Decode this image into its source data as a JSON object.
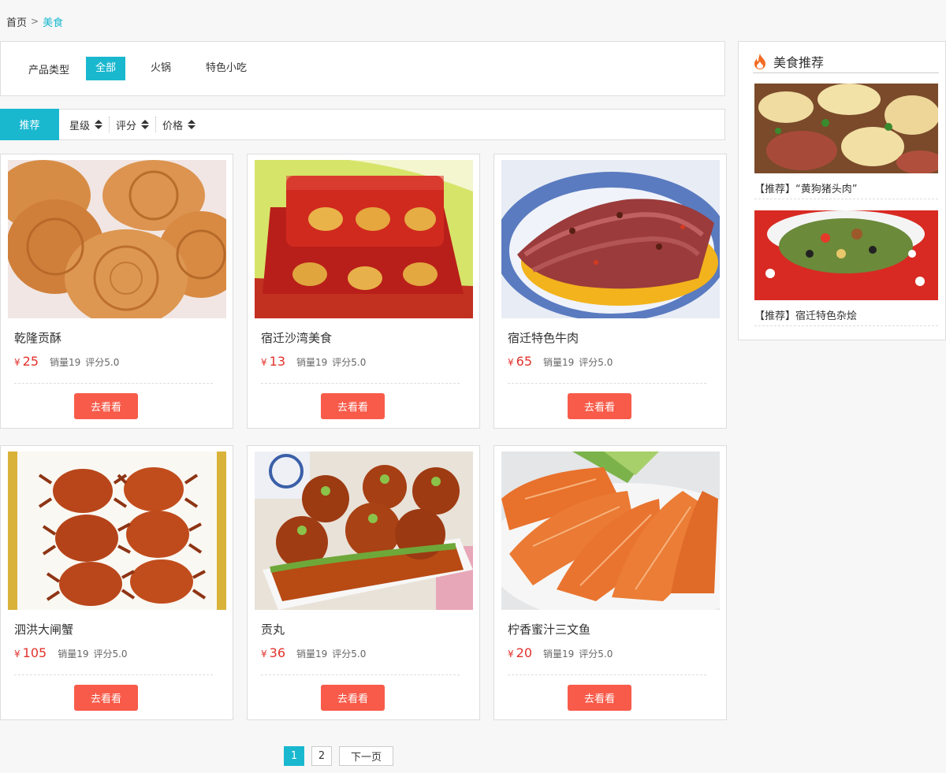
{
  "breadcrumb": {
    "home": "首页",
    "current": "美食"
  },
  "filter": {
    "title": "产品类型",
    "options": [
      {
        "label": "全部",
        "active": true
      },
      {
        "label": "火锅",
        "active": false
      },
      {
        "label": "特色小吃",
        "active": false
      }
    ]
  },
  "sort": {
    "active": "推荐",
    "items": [
      "星级",
      "评分",
      "价格"
    ]
  },
  "products": [
    {
      "name": "乾隆贡酥",
      "currency": "¥",
      "price": "25",
      "sales": "销量19",
      "rating": "评分5.0",
      "button": "去看看",
      "image": "pastry"
    },
    {
      "name": "宿迁沙湾美食",
      "currency": "¥",
      "price": "13",
      "sales": "销量19",
      "rating": "评分5.0",
      "button": "去看看",
      "image": "jelly"
    },
    {
      "name": "宿迁特色牛肉",
      "currency": "¥",
      "price": "65",
      "sales": "销量19",
      "rating": "评分5.0",
      "button": "去看看",
      "image": "beef"
    },
    {
      "name": "泗洪大闸蟹",
      "currency": "¥",
      "price": "105",
      "sales": "销量19",
      "rating": "评分5.0",
      "button": "去看看",
      "image": "crabs"
    },
    {
      "name": "贡丸",
      "currency": "¥",
      "price": "36",
      "sales": "销量19",
      "rating": "评分5.0",
      "button": "去看看",
      "image": "meatballs"
    },
    {
      "name": "柠香蜜汁三文鱼",
      "currency": "¥",
      "price": "20",
      "sales": "销量19",
      "rating": "评分5.0",
      "button": "去看看",
      "image": "salmon"
    }
  ],
  "pagination": {
    "pages": [
      "1",
      "2"
    ],
    "current": "1",
    "next": "下一页"
  },
  "sidebar": {
    "title": "美食推荐",
    "items": [
      {
        "caption": "【推荐】“黄狗猪头肉”",
        "image": "stirfry"
      },
      {
        "caption": "【推荐】宿迁特色杂烩",
        "image": "bowl"
      }
    ]
  },
  "colors": {
    "accent": "#1ab8cf",
    "price": "#e2322c",
    "button": "#f85b4a"
  }
}
